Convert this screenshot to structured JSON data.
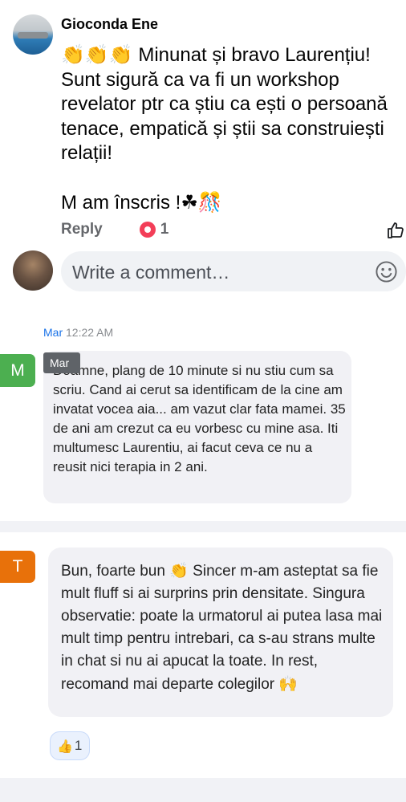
{
  "facebook_comment": {
    "author": "Gioconda Ene",
    "body_line1_emoji": "👏👏👏",
    "body_line1_text": " Minunat și bravo Laurențiu!",
    "body_rest": "Sunt sigură ca va fi un workshop revelator ptr ca știu ca ești o persoană tenace, empatică și știi sa construiești relații!",
    "signup_text": "M am înscris !",
    "signup_emoji": "☘🎊",
    "reply_label": "Reply",
    "reaction_count": "1",
    "write_comment_placeholder": "Write a comment…"
  },
  "chat": {
    "message1": {
      "day": "Mar",
      "time": "12:22 AM",
      "avatar_letter": "M",
      "tooltip": "Mar",
      "text": "Doamne, plang de 10 minute si nu stiu cum sa scriu. Cand ai cerut sa identificam de la cine am invatat vocea aia... am vazut clar fata mamei. 35 de ani am crezut ca eu vorbesc cu mine asa. Iti multumesc Laurentiu, ai facut ceva ce nu a reusit nici terapia in 2 ani."
    },
    "message2": {
      "avatar_letter": "T",
      "text_start": "Bun, foarte bun ",
      "emoji_wave": "👏",
      "text_rest": " Sincer m-am asteptat sa fie mult fluff si ai surprins prin densitate. Singura observatie: poate la urmatorul ai putea lasa mai mult timp pentru intrebari, ca s-au strans multe in chat si nu ai apucat la toate. In rest, recomand mai departe colegilor ",
      "emoji_end": "🙌",
      "reaction_emoji": "👍",
      "reaction_count": "1"
    }
  },
  "colors": {
    "heart_reaction": "#f33e58",
    "avatar_m": "#4caf50",
    "avatar_t": "#e8710a",
    "timestamp_day": "#1a73e8"
  }
}
